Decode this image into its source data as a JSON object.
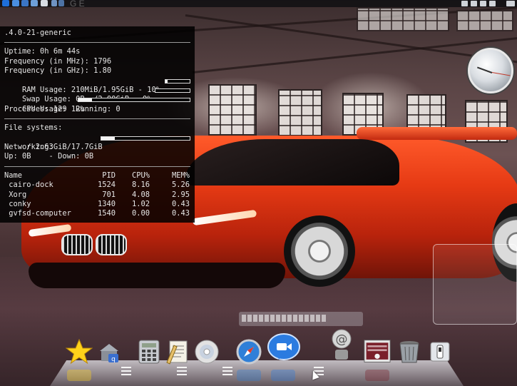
{
  "top_panel": {
    "ghost_text": "G  E",
    "accent": "#1e6fd9"
  },
  "conky": {
    "kernel": ".4.0-21-generic",
    "uptime": "Uptime: 0h 6m 44s",
    "freq_mhz": "Frequency (in MHz): 1796",
    "freq_ghz": "Frequency (in GHz): 1.80",
    "ram": {
      "label": "RAM Usage: 210MiB/1.95GiB - 10%",
      "percent": 10
    },
    "swap": {
      "label": "Swap Usage: 0B  /2.00GiB - 0%",
      "percent": 0
    },
    "cpu": {
      "label": "CPU Usage: 12%",
      "percent": 12
    },
    "processes": "Processes: 129  Running: 0",
    "filesystems_heading": "File systems:",
    "root_fs": {
      "label": " / 2.63GiB/17.7GiB",
      "percent": 15
    },
    "networking_heading": "Networking:",
    "net": "Up: 0B    - Down: 0B",
    "table": {
      "headers": [
        "Name",
        "PID",
        "CPU%",
        "MEM%"
      ],
      "rows": [
        [
          " cairo-dock",
          "1524",
          "8.16",
          "5.26"
        ],
        [
          " Xorg",
          "701",
          "4.08",
          "2.95"
        ],
        [
          " conky",
          "1340",
          "1.02",
          "0.43"
        ],
        [
          " gvfsd-computer",
          "1540",
          "0.00",
          "0.43"
        ]
      ]
    }
  },
  "dock": {
    "items": [
      {
        "icon": "star-icon",
        "color": "#ffd21a"
      },
      {
        "icon": "app-install-icon",
        "color": "#8a8f98"
      },
      {
        "icon": "calculator-icon",
        "color": "#c9ccd1"
      },
      {
        "icon": "text-editor-icon",
        "color": "#e7c06a"
      },
      {
        "icon": "disc-icon",
        "color": "#d7d7d7"
      },
      {
        "icon": "safari-compass-icon",
        "color": "#2f7fd8"
      },
      {
        "icon": "video-chat-icon",
        "color": "#2b7be0"
      },
      {
        "icon": "mail-at-icon",
        "color": "#bfbfbf"
      },
      {
        "icon": "system-monitor-icon",
        "color": "#7a1f2a"
      },
      {
        "icon": "trash-icon",
        "color": "#9aa0a6"
      },
      {
        "icon": "switch-icon",
        "color": "#e3e6ea"
      }
    ]
  }
}
